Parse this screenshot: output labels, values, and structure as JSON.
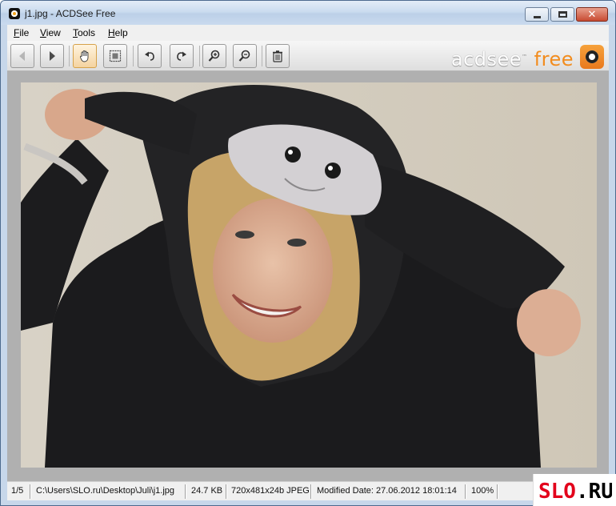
{
  "window": {
    "title": "j1.jpg - ACDSee Free",
    "min_icon": "minimize-icon",
    "max_icon": "maximize-icon",
    "close_icon": "close-icon",
    "close_glyph": "✕"
  },
  "menu": [
    {
      "label": "File",
      "key": "F"
    },
    {
      "label": "View",
      "key": "V"
    },
    {
      "label": "Tools",
      "key": "T"
    },
    {
      "label": "Help",
      "key": "H"
    }
  ],
  "toolbar": {
    "buttons": [
      {
        "name": "previous-button",
        "icon": "arrow-left-icon",
        "state": "disabled"
      },
      {
        "name": "next-button",
        "icon": "arrow-right-icon",
        "state": "normal"
      },
      {
        "name": "hand-tool-button",
        "icon": "hand-icon",
        "state": "active"
      },
      {
        "name": "fit-to-window-button",
        "icon": "fit-frame-icon",
        "state": "normal"
      },
      {
        "name": "rotate-left-button",
        "icon": "rotate-left-icon",
        "state": "normal"
      },
      {
        "name": "rotate-right-button",
        "icon": "rotate-right-icon",
        "state": "normal"
      },
      {
        "name": "zoom-in-button",
        "icon": "zoom-in-icon",
        "state": "normal"
      },
      {
        "name": "zoom-out-button",
        "icon": "zoom-out-icon",
        "state": "normal"
      },
      {
        "name": "delete-button",
        "icon": "trash-icon",
        "state": "normal"
      }
    ]
  },
  "logo": {
    "part1": "acdsee",
    "part2": "free",
    "icon": "camera-icon",
    "accent": "#f28c1e"
  },
  "image": {
    "subject": "photo-icon",
    "description_icon": "image-content"
  },
  "status": {
    "index": "1/5",
    "path": "C:\\Users\\SLO.ru\\Desktop\\Juli\\j1.jpg",
    "size": "24.7 KB",
    "dimensions": "720x481x24b JPEG",
    "modified": "Modified Date: 27.06.2012 18:01:14",
    "zoom": "100%"
  },
  "watermark": {
    "text": "SLO.RU",
    "color_red": "#e3001b",
    "color_black": "#000000"
  }
}
